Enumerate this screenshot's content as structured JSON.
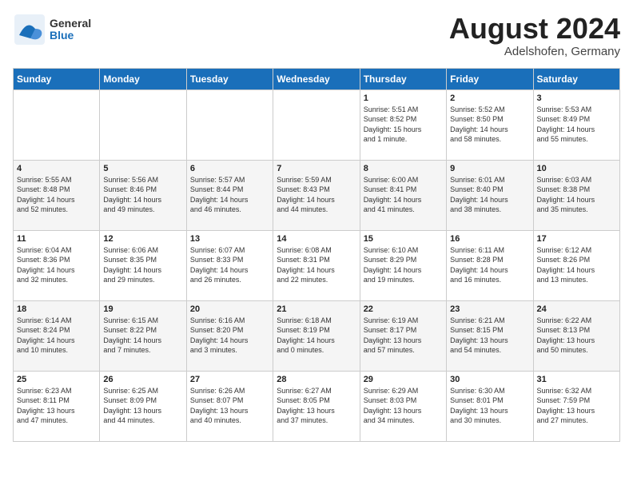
{
  "header": {
    "logo_general": "General",
    "logo_blue": "Blue",
    "month_year": "August 2024",
    "location": "Adelshofen, Germany"
  },
  "days_of_week": [
    "Sunday",
    "Monday",
    "Tuesday",
    "Wednesday",
    "Thursday",
    "Friday",
    "Saturday"
  ],
  "weeks": [
    [
      {
        "day": "",
        "content": ""
      },
      {
        "day": "",
        "content": ""
      },
      {
        "day": "",
        "content": ""
      },
      {
        "day": "",
        "content": ""
      },
      {
        "day": "1",
        "content": "Sunrise: 5:51 AM\nSunset: 8:52 PM\nDaylight: 15 hours\nand 1 minute."
      },
      {
        "day": "2",
        "content": "Sunrise: 5:52 AM\nSunset: 8:50 PM\nDaylight: 14 hours\nand 58 minutes."
      },
      {
        "day": "3",
        "content": "Sunrise: 5:53 AM\nSunset: 8:49 PM\nDaylight: 14 hours\nand 55 minutes."
      }
    ],
    [
      {
        "day": "4",
        "content": "Sunrise: 5:55 AM\nSunset: 8:48 PM\nDaylight: 14 hours\nand 52 minutes."
      },
      {
        "day": "5",
        "content": "Sunrise: 5:56 AM\nSunset: 8:46 PM\nDaylight: 14 hours\nand 49 minutes."
      },
      {
        "day": "6",
        "content": "Sunrise: 5:57 AM\nSunset: 8:44 PM\nDaylight: 14 hours\nand 46 minutes."
      },
      {
        "day": "7",
        "content": "Sunrise: 5:59 AM\nSunset: 8:43 PM\nDaylight: 14 hours\nand 44 minutes."
      },
      {
        "day": "8",
        "content": "Sunrise: 6:00 AM\nSunset: 8:41 PM\nDaylight: 14 hours\nand 41 minutes."
      },
      {
        "day": "9",
        "content": "Sunrise: 6:01 AM\nSunset: 8:40 PM\nDaylight: 14 hours\nand 38 minutes."
      },
      {
        "day": "10",
        "content": "Sunrise: 6:03 AM\nSunset: 8:38 PM\nDaylight: 14 hours\nand 35 minutes."
      }
    ],
    [
      {
        "day": "11",
        "content": "Sunrise: 6:04 AM\nSunset: 8:36 PM\nDaylight: 14 hours\nand 32 minutes."
      },
      {
        "day": "12",
        "content": "Sunrise: 6:06 AM\nSunset: 8:35 PM\nDaylight: 14 hours\nand 29 minutes."
      },
      {
        "day": "13",
        "content": "Sunrise: 6:07 AM\nSunset: 8:33 PM\nDaylight: 14 hours\nand 26 minutes."
      },
      {
        "day": "14",
        "content": "Sunrise: 6:08 AM\nSunset: 8:31 PM\nDaylight: 14 hours\nand 22 minutes."
      },
      {
        "day": "15",
        "content": "Sunrise: 6:10 AM\nSunset: 8:29 PM\nDaylight: 14 hours\nand 19 minutes."
      },
      {
        "day": "16",
        "content": "Sunrise: 6:11 AM\nSunset: 8:28 PM\nDaylight: 14 hours\nand 16 minutes."
      },
      {
        "day": "17",
        "content": "Sunrise: 6:12 AM\nSunset: 8:26 PM\nDaylight: 14 hours\nand 13 minutes."
      }
    ],
    [
      {
        "day": "18",
        "content": "Sunrise: 6:14 AM\nSunset: 8:24 PM\nDaylight: 14 hours\nand 10 minutes."
      },
      {
        "day": "19",
        "content": "Sunrise: 6:15 AM\nSunset: 8:22 PM\nDaylight: 14 hours\nand 7 minutes."
      },
      {
        "day": "20",
        "content": "Sunrise: 6:16 AM\nSunset: 8:20 PM\nDaylight: 14 hours\nand 3 minutes."
      },
      {
        "day": "21",
        "content": "Sunrise: 6:18 AM\nSunset: 8:19 PM\nDaylight: 14 hours\nand 0 minutes."
      },
      {
        "day": "22",
        "content": "Sunrise: 6:19 AM\nSunset: 8:17 PM\nDaylight: 13 hours\nand 57 minutes."
      },
      {
        "day": "23",
        "content": "Sunrise: 6:21 AM\nSunset: 8:15 PM\nDaylight: 13 hours\nand 54 minutes."
      },
      {
        "day": "24",
        "content": "Sunrise: 6:22 AM\nSunset: 8:13 PM\nDaylight: 13 hours\nand 50 minutes."
      }
    ],
    [
      {
        "day": "25",
        "content": "Sunrise: 6:23 AM\nSunset: 8:11 PM\nDaylight: 13 hours\nand 47 minutes."
      },
      {
        "day": "26",
        "content": "Sunrise: 6:25 AM\nSunset: 8:09 PM\nDaylight: 13 hours\nand 44 minutes."
      },
      {
        "day": "27",
        "content": "Sunrise: 6:26 AM\nSunset: 8:07 PM\nDaylight: 13 hours\nand 40 minutes."
      },
      {
        "day": "28",
        "content": "Sunrise: 6:27 AM\nSunset: 8:05 PM\nDaylight: 13 hours\nand 37 minutes."
      },
      {
        "day": "29",
        "content": "Sunrise: 6:29 AM\nSunset: 8:03 PM\nDaylight: 13 hours\nand 34 minutes."
      },
      {
        "day": "30",
        "content": "Sunrise: 6:30 AM\nSunset: 8:01 PM\nDaylight: 13 hours\nand 30 minutes."
      },
      {
        "day": "31",
        "content": "Sunrise: 6:32 AM\nSunset: 7:59 PM\nDaylight: 13 hours\nand 27 minutes."
      }
    ]
  ]
}
